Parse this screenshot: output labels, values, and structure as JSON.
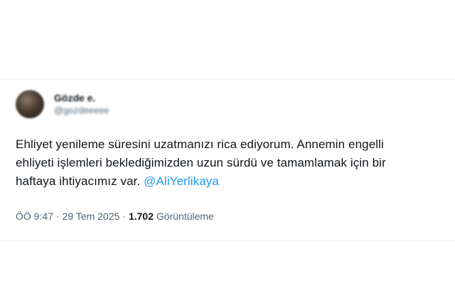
{
  "tweet": {
    "author": {
      "display_name": "Gözde e.",
      "handle": "@gozdeeeee"
    },
    "text_line1": "Ehliyet yenileme süresini uzatmanızı rica ediyorum. Annemin engelli",
    "text_line2": "ehliyeti işlemleri beklediğimizden uzun sürdü ve tamamlamak için bir",
    "text_line3": "haftaya ihtiyacımız var. ",
    "mention": "@AliYerlikaya",
    "time": "ÖÖ 9:47",
    "separator": "·",
    "date": "29 Tem 2025",
    "views_count": "1.702",
    "views_label": "Görüntüleme"
  }
}
